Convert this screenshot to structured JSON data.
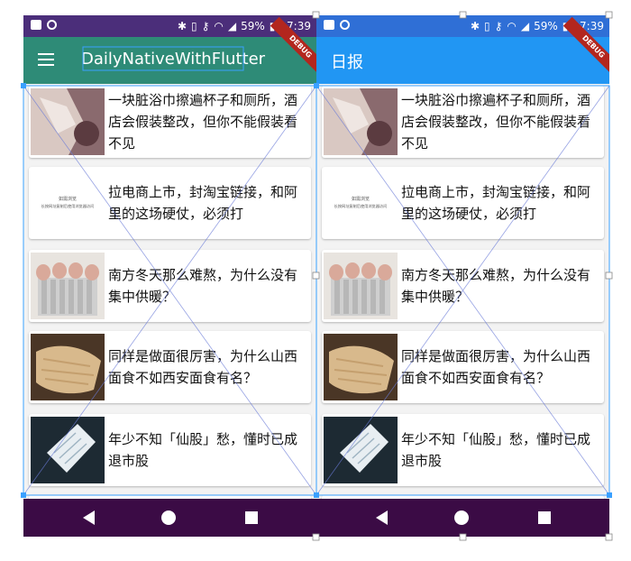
{
  "status_bar": {
    "battery": "59%",
    "time": "17:39"
  },
  "left_app": {
    "title": "DailyNativeWithFlutter",
    "debug_banner": "DEBUG"
  },
  "right_app": {
    "title": "日报",
    "debug_banner": "DEBUG"
  },
  "articles": [
    {
      "title": "一块脏浴巾擦遍杯子和厕所，酒店会假装整改，但你不能假装看不见",
      "thumb": "towel-photo"
    },
    {
      "title": "拉电商上市，封淘宝链接，和阿里的这场硬仗，必须打",
      "thumb": "text-placeholder",
      "thumb_text_1": "如需浏览",
      "thumb_text_2": "长按网址复制后使用浏览器访问"
    },
    {
      "title": "南方冬天那么难熬，为什么没有集中供暖？",
      "thumb": "radiator-photo"
    },
    {
      "title": "同样是做面很厉害，为什么山西面食不如西安面食有名？",
      "thumb": "noodle-photo"
    },
    {
      "title": "年少不知「仙股」愁，懂时已成退市股",
      "thumb": "stock-paper-photo"
    }
  ],
  "colors": {
    "left_appbar": "#2e8b77",
    "right_appbar": "#2196f3",
    "navbar": "#3b0b45"
  }
}
